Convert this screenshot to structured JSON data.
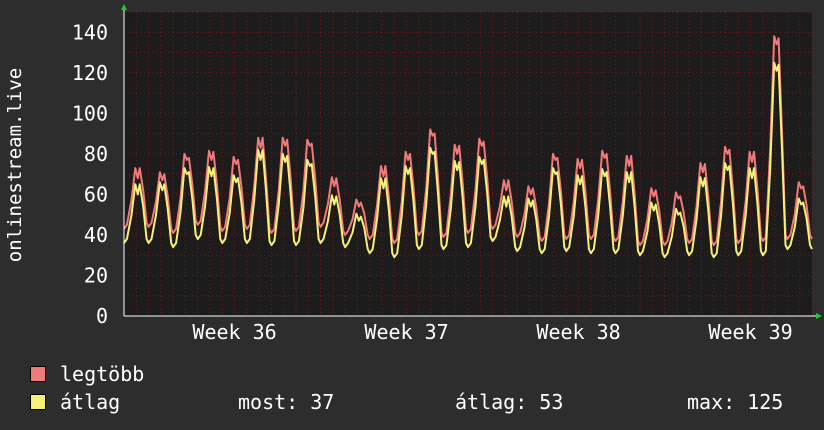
{
  "colors": {
    "background": "#2d2d2d",
    "plot_background": "#1c1c1c",
    "max_series": "#f07a7a",
    "avg_series": "#f5f07a",
    "grid": "#7a2020",
    "axis_arrow": "#22cc22"
  },
  "chart_data": {
    "type": "line",
    "ylabel": "onlinestream.live",
    "ylim": [
      0,
      150
    ],
    "yticks": [
      0,
      20,
      40,
      60,
      80,
      100,
      120,
      140
    ],
    "xlim": [
      0,
      28
    ],
    "x_tick_labels": [
      {
        "label": "Week 36",
        "x": 4.5
      },
      {
        "label": "Week 37",
        "x": 11.5
      },
      {
        "label": "Week 38",
        "x": 18.5
      },
      {
        "label": "Week 39",
        "x": 25.5
      }
    ],
    "grid": true,
    "legend_placement": "bottom-left",
    "day_peaks": [
      {
        "max": 74,
        "avg": 66
      },
      {
        "max": 71,
        "avg": 66
      },
      {
        "max": 79,
        "avg": 72
      },
      {
        "max": 82,
        "avg": 74
      },
      {
        "max": 78,
        "avg": 69
      },
      {
        "max": 89,
        "avg": 83
      },
      {
        "max": 88,
        "avg": 80
      },
      {
        "max": 86,
        "avg": 76
      },
      {
        "max": 69,
        "avg": 60
      },
      {
        "max": 57,
        "avg": 50
      },
      {
        "max": 75,
        "avg": 69
      },
      {
        "max": 81,
        "avg": 74
      },
      {
        "max": 91,
        "avg": 82
      },
      {
        "max": 85,
        "avg": 77
      },
      {
        "max": 87,
        "avg": 78
      },
      {
        "max": 68,
        "avg": 60
      },
      {
        "max": 64,
        "avg": 58
      },
      {
        "max": 79,
        "avg": 72
      },
      {
        "max": 78,
        "avg": 70
      },
      {
        "max": 81,
        "avg": 72
      },
      {
        "max": 80,
        "avg": 72
      },
      {
        "max": 63,
        "avg": 56
      },
      {
        "max": 60,
        "avg": 52
      },
      {
        "max": 76,
        "avg": 69
      },
      {
        "max": 83,
        "avg": 75
      },
      {
        "max": 82,
        "avg": 74
      },
      {
        "max": 138,
        "avg": 125
      },
      {
        "max": 65,
        "avg": 57
      }
    ],
    "day_troughs": [
      {
        "max": 43,
        "avg": 36
      },
      {
        "max": 44,
        "avg": 36
      },
      {
        "max": 41,
        "avg": 34
      },
      {
        "max": 45,
        "avg": 38
      },
      {
        "max": 42,
        "avg": 36
      },
      {
        "max": 43,
        "avg": 36
      },
      {
        "max": 41,
        "avg": 35
      },
      {
        "max": 42,
        "avg": 35
      },
      {
        "max": 44,
        "avg": 36
      },
      {
        "max": 40,
        "avg": 34
      },
      {
        "max": 38,
        "avg": 31
      },
      {
        "max": 36,
        "avg": 29
      },
      {
        "max": 40,
        "avg": 33
      },
      {
        "max": 39,
        "avg": 33
      },
      {
        "max": 41,
        "avg": 34
      },
      {
        "max": 43,
        "avg": 37
      },
      {
        "max": 39,
        "avg": 32
      },
      {
        "max": 37,
        "avg": 31
      },
      {
        "max": 38,
        "avg": 32
      },
      {
        "max": 38,
        "avg": 31
      },
      {
        "max": 37,
        "avg": 31
      },
      {
        "max": 35,
        "avg": 30
      },
      {
        "max": 35,
        "avg": 29
      },
      {
        "max": 36,
        "avg": 30
      },
      {
        "max": 35,
        "avg": 29
      },
      {
        "max": 36,
        "avg": 30
      },
      {
        "max": 37,
        "avg": 30
      },
      {
        "max": 38,
        "avg": 33
      },
      {
        "max": 38,
        "avg": 33
      }
    ],
    "series": [
      {
        "name": "legtöbb",
        "key": "max",
        "color": "#f07a7a"
      },
      {
        "name": "átlag",
        "key": "avg",
        "color": "#f5f07a"
      }
    ]
  },
  "stats": {
    "current": "most: 37",
    "average": "átlag: 53",
    "maximum": "max: 125"
  }
}
